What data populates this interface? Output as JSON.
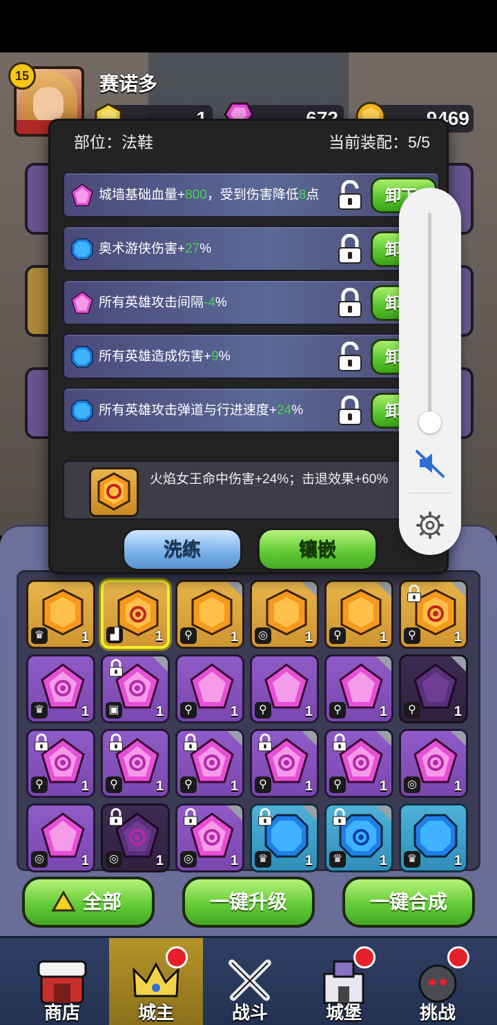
{
  "player": {
    "level": "15",
    "name": "赛诺多",
    "resources": [
      {
        "icon": "yellow-gem-icon",
        "value": "1"
      },
      {
        "icon": "pink-crystal-icon",
        "value": "672"
      },
      {
        "icon": "gold-coin-icon",
        "value": "9469"
      }
    ]
  },
  "modal": {
    "slot_label": "部位：法鞋",
    "equip_label": "当前装配：5/5",
    "affixes": [
      {
        "gem": "pink",
        "text": "城墙基础血量+",
        "num1": "800",
        "text2": "，受到伤害降低",
        "num2": "8",
        "text3": "点",
        "locked": false,
        "button": "卸下"
      },
      {
        "gem": "blue",
        "text": "奥术游侠伤害+",
        "num1": "27",
        "text2": "%",
        "num2": "",
        "text3": "",
        "locked": true,
        "button": "卸下"
      },
      {
        "gem": "pink",
        "text": "所有英雄攻击间隔",
        "num1": "-4",
        "text2": "%",
        "num2": "",
        "text3": "",
        "locked": true,
        "button": "卸下"
      },
      {
        "gem": "blue",
        "text": "所有英雄造成伤害+",
        "num1": "9",
        "text2": "%",
        "num2": "",
        "text3": "",
        "locked": false,
        "button": "卸下"
      },
      {
        "gem": "blue",
        "text": "所有英雄攻击弹道与行进速度+",
        "num1": "24",
        "text2": "%",
        "num2": "",
        "text3": "",
        "locked": true,
        "button": "卸下"
      }
    ],
    "set_bonus": "火焰女王命中伤害+24%；击退效果+60%",
    "wash_button": "洗练",
    "inlay_button": "镶嵌"
  },
  "volume": {
    "level": 0.1,
    "muted": true
  },
  "inventory": {
    "rows": [
      [
        {
          "color": "gold",
          "swirl": false,
          "lock": false,
          "corner": false,
          "slot": "crown",
          "count": "1",
          "selected": false
        },
        {
          "color": "gold",
          "swirl": true,
          "lock": false,
          "corner": false,
          "slot": "boot",
          "count": "1",
          "selected": true
        },
        {
          "color": "gold",
          "swirl": false,
          "lock": false,
          "corner": true,
          "slot": "wand",
          "count": "1",
          "selected": false
        },
        {
          "color": "gold",
          "swirl": false,
          "lock": false,
          "corner": true,
          "slot": "ring",
          "count": "1",
          "selected": false
        },
        {
          "color": "gold",
          "swirl": false,
          "lock": false,
          "corner": true,
          "slot": "staff",
          "count": "1",
          "selected": false
        },
        {
          "color": "gold",
          "swirl": true,
          "lock": true,
          "corner": true,
          "slot": "staff",
          "count": "1",
          "selected": false
        }
      ],
      [
        {
          "color": "purple",
          "swirl": true,
          "lock": false,
          "corner": false,
          "slot": "crown",
          "count": "1",
          "selected": false
        },
        {
          "color": "purple",
          "swirl": true,
          "lock": true,
          "corner": true,
          "slot": "armor",
          "count": "1",
          "selected": false
        },
        {
          "color": "purple",
          "swirl": false,
          "lock": false,
          "corner": false,
          "slot": "wand",
          "count": "1",
          "selected": false
        },
        {
          "color": "purple",
          "swirl": false,
          "lock": false,
          "corner": false,
          "slot": "wand",
          "count": "1",
          "selected": false
        },
        {
          "color": "purple",
          "swirl": false,
          "lock": false,
          "corner": true,
          "slot": "wand",
          "count": "1",
          "selected": false
        },
        {
          "color": "dark",
          "swirl": false,
          "lock": false,
          "corner": true,
          "slot": "wand",
          "count": "1",
          "selected": false
        }
      ],
      [
        {
          "color": "purple",
          "swirl": true,
          "lock": true,
          "corner": false,
          "slot": "wand",
          "count": "1",
          "selected": false
        },
        {
          "color": "purple",
          "swirl": true,
          "lock": true,
          "corner": false,
          "slot": "wand",
          "count": "1",
          "selected": false
        },
        {
          "color": "purple",
          "swirl": true,
          "lock": true,
          "corner": true,
          "slot": "wand",
          "count": "1",
          "selected": false
        },
        {
          "color": "purple",
          "swirl": true,
          "lock": true,
          "corner": true,
          "slot": "wand",
          "count": "1",
          "selected": false
        },
        {
          "color": "purple",
          "swirl": true,
          "lock": true,
          "corner": true,
          "slot": "wand",
          "count": "1",
          "selected": false
        },
        {
          "color": "purple",
          "swirl": true,
          "lock": false,
          "corner": true,
          "slot": "ring",
          "count": "1",
          "selected": false
        }
      ],
      [
        {
          "color": "purple",
          "swirl": false,
          "lock": false,
          "corner": false,
          "slot": "ring",
          "count": "1",
          "selected": false
        },
        {
          "color": "dark",
          "swirl": true,
          "lock": true,
          "corner": false,
          "slot": "ring",
          "count": "1",
          "selected": false
        },
        {
          "color": "purple",
          "swirl": true,
          "lock": true,
          "corner": true,
          "slot": "ring",
          "count": "1",
          "selected": false
        },
        {
          "color": "blue",
          "swirl": false,
          "lock": true,
          "corner": true,
          "slot": "crown",
          "count": "1",
          "selected": false
        },
        {
          "color": "blue",
          "swirl": true,
          "lock": true,
          "corner": true,
          "slot": "crown",
          "count": "1",
          "selected": false
        },
        {
          "color": "blue",
          "swirl": false,
          "lock": false,
          "corner": false,
          "slot": "crown",
          "count": "1",
          "selected": false
        }
      ]
    ]
  },
  "actions": {
    "all_label": "全部",
    "upgrade_label": "一键升级",
    "combine_label": "一键合成"
  },
  "nav": [
    {
      "label": "商店",
      "icon": "shop-icon",
      "active": false,
      "dot": false
    },
    {
      "label": "城主",
      "icon": "crown-icon",
      "active": true,
      "dot": true
    },
    {
      "label": "战斗",
      "icon": "swords-icon",
      "active": false,
      "dot": false
    },
    {
      "label": "城堡",
      "icon": "castle-icon",
      "active": false,
      "dot": true
    },
    {
      "label": "挑战",
      "icon": "bomb-icon",
      "active": false,
      "dot": true
    }
  ],
  "colors": {
    "green_number": "#4ed04e",
    "selected_border": "#f4f02a",
    "notification_dot": "#e6202a"
  }
}
